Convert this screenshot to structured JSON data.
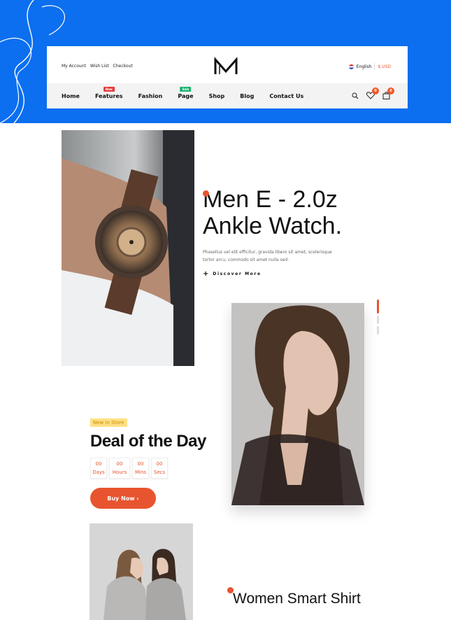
{
  "topbar": {
    "links": [
      "My Account",
      "Wish List",
      "Checkout"
    ],
    "language": "English",
    "currency": "$ USD"
  },
  "nav": {
    "items": [
      {
        "label": "Home",
        "badge": ""
      },
      {
        "label": "Features",
        "badge": "New"
      },
      {
        "label": "Fashion",
        "badge": ""
      },
      {
        "label": "Page",
        "badge": "Sale"
      },
      {
        "label": "Shop",
        "badge": ""
      },
      {
        "label": "Blog",
        "badge": ""
      },
      {
        "label": "Contact Us",
        "badge": ""
      }
    ],
    "wishlist_count": "0",
    "cart_count": "0"
  },
  "hero": {
    "title_line1": "Men E - 2.0z",
    "title_line2": "Ankle Watch.",
    "description": "Phasellus vel elit efficitur, gravida libero sit amet, scelerisque tortor arcu, commodo sit amet nulla sed.",
    "cta_label": "Discover More"
  },
  "deal": {
    "tag": "New in Store",
    "title": "Deal of the Day",
    "countdown": [
      {
        "value": "00",
        "unit": "Days"
      },
      {
        "value": "00",
        "unit": "Hours"
      },
      {
        "value": "00",
        "unit": "Mins"
      },
      {
        "value": "00",
        "unit": "Secs"
      }
    ],
    "button_label": "Buy Now ›"
  },
  "next_section": {
    "title": "Women Smart Shirt"
  },
  "colors": {
    "brand_blue": "#0b6ff0",
    "accent": "#e8542f",
    "new_badge": "#e73b3b",
    "sale_badge": "#19b36e"
  }
}
